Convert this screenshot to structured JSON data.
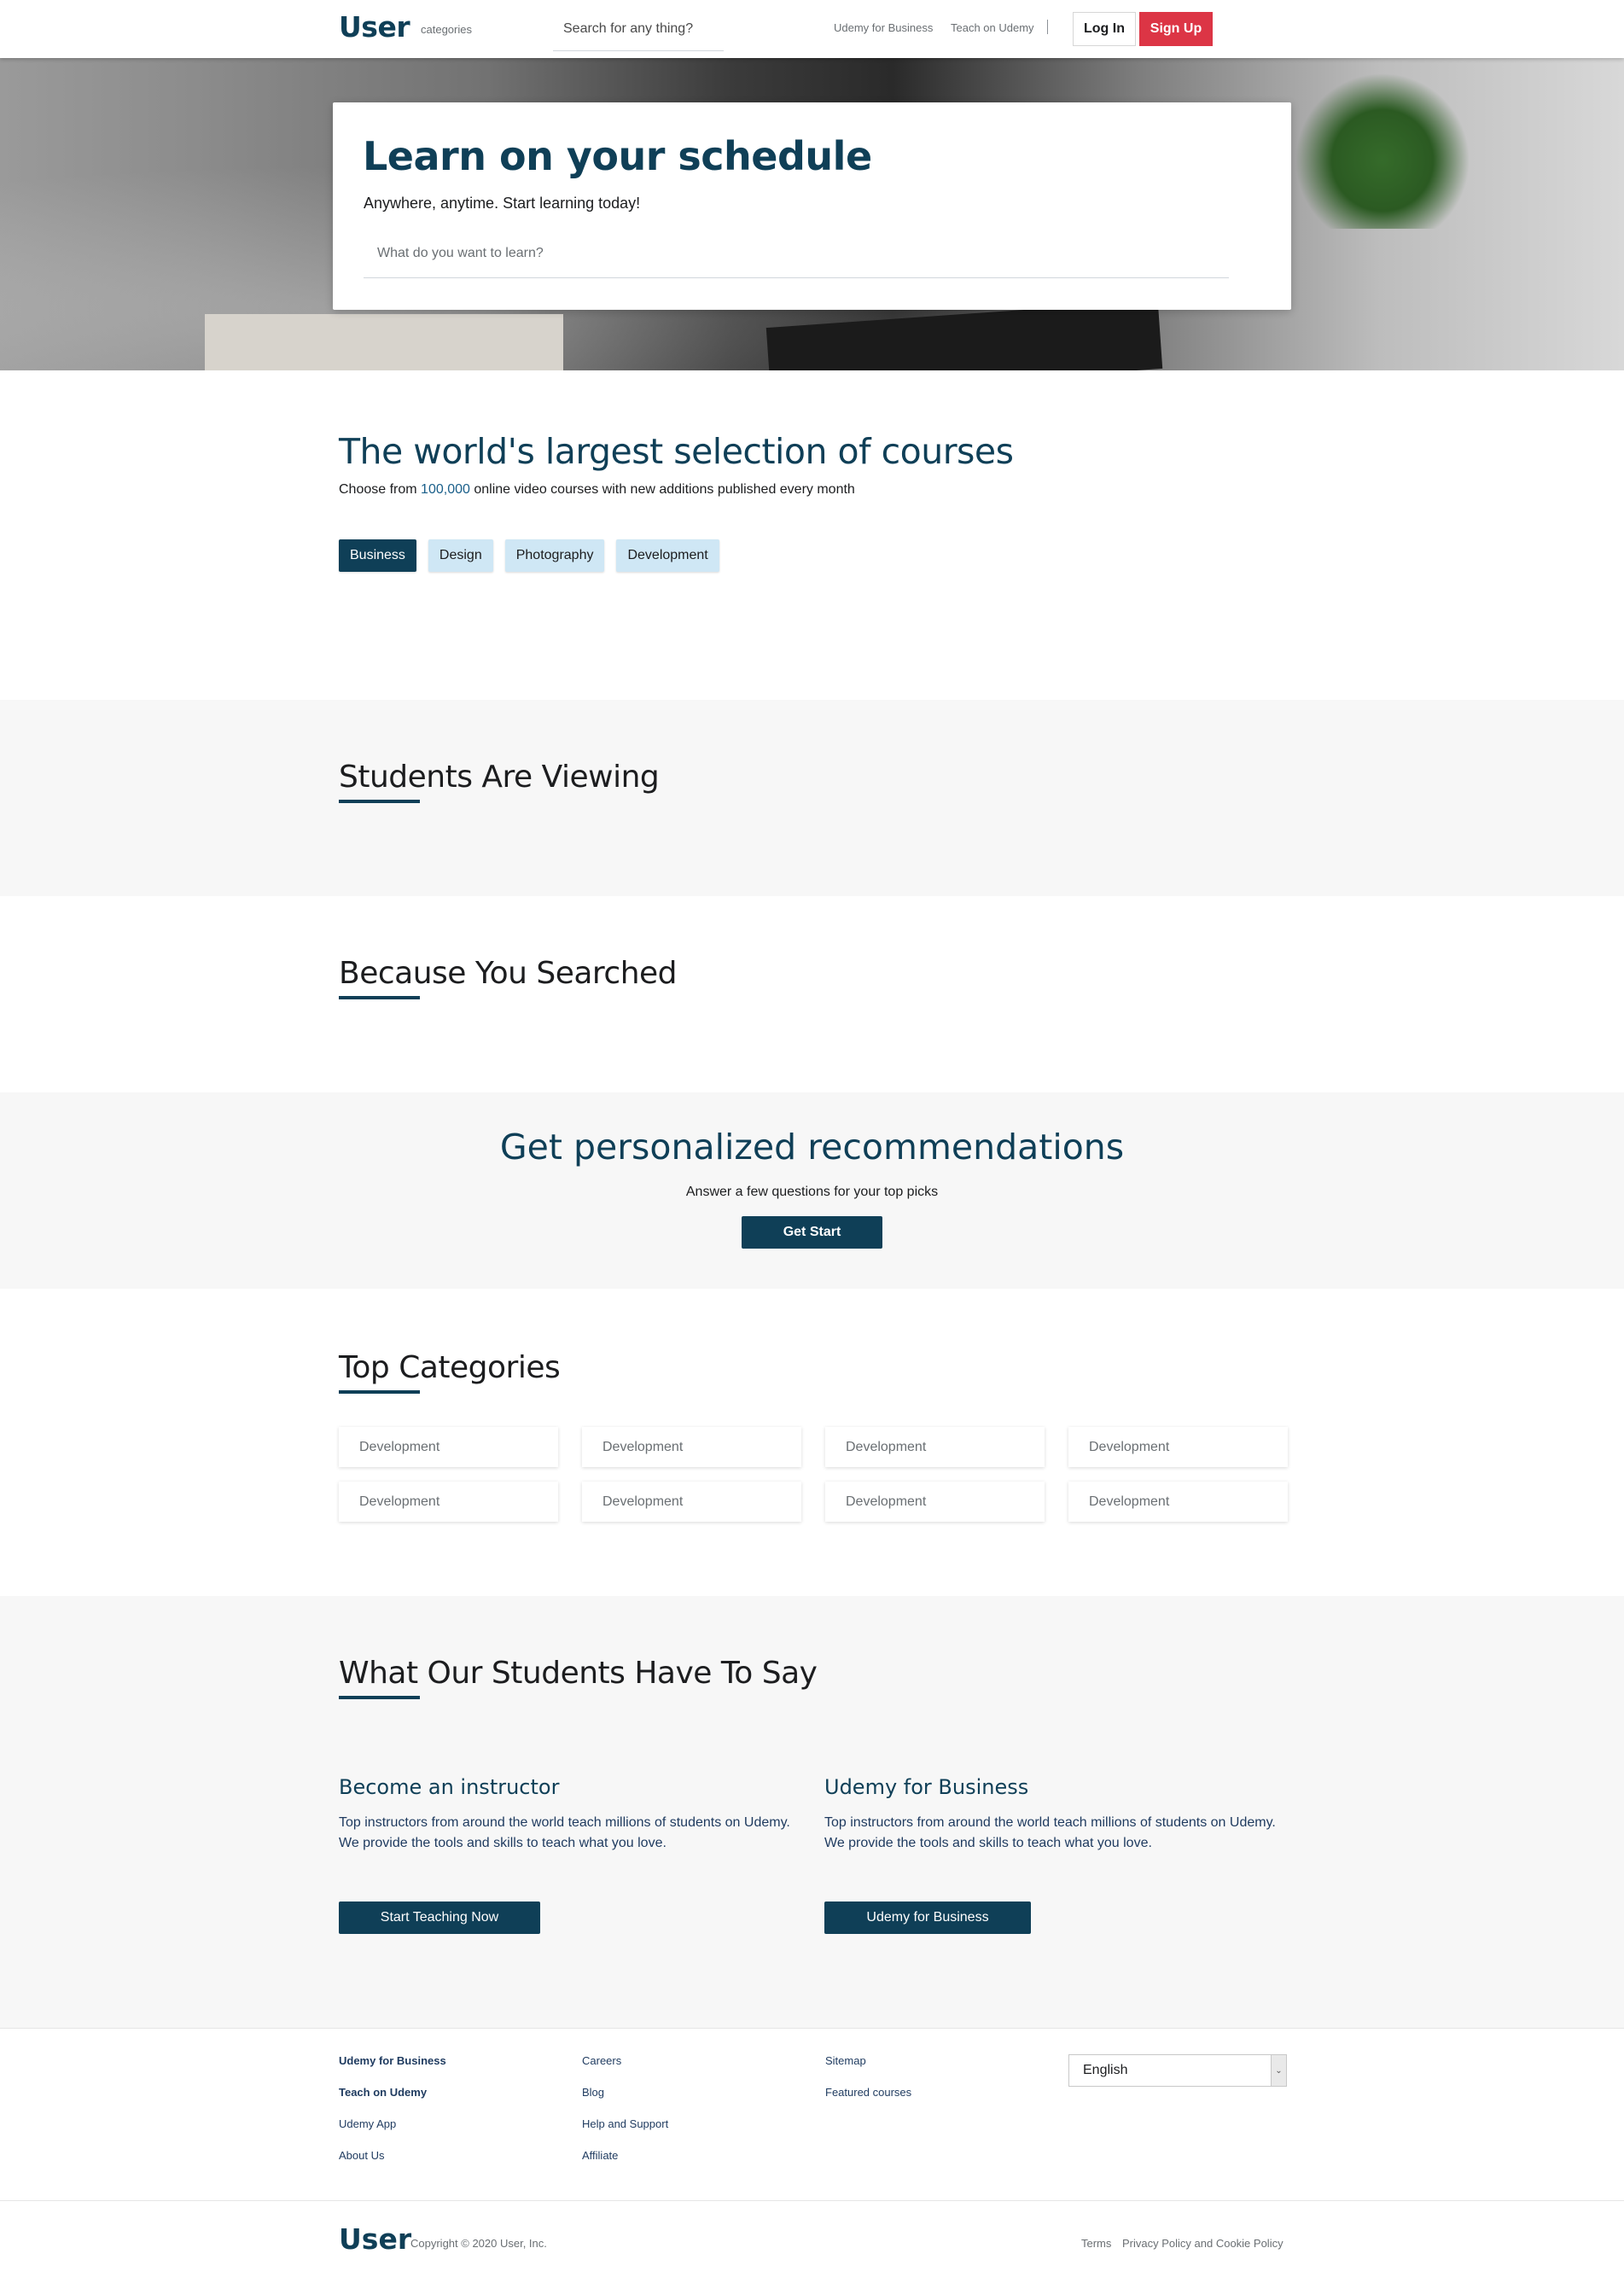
{
  "navbar": {
    "logo": "User",
    "categories": "categories",
    "search_placeholder": "Search for any thing?",
    "links": [
      "Udemy for Business",
      "Teach on Udemy"
    ],
    "login": "Log In",
    "signup": "Sign Up"
  },
  "hero": {
    "title": "Learn on your schedule",
    "subtitle": "Anywhere, anytime. Start learning today!",
    "search_placeholder": "What do you want to learn?"
  },
  "courses": {
    "title": "The world's largest selection of courses",
    "sub_prefix": "Choose from ",
    "sub_number": "100,000",
    "sub_suffix": " online video courses with new additions published every month",
    "tabs": [
      "Business",
      "Design",
      "Photography",
      "Development"
    ],
    "active_tab": "Business"
  },
  "students_viewing": {
    "title": "Students Are Viewing"
  },
  "because_searched": {
    "title": "Because You Searched"
  },
  "personalized": {
    "title": "Get personalized recommendations",
    "subtitle": "Answer a few questions for your top picks",
    "button": "Get Start"
  },
  "top_categories": {
    "title": "Top Categories",
    "items": [
      "Development",
      "Development",
      "Development",
      "Development",
      "Development",
      "Development",
      "Development",
      "Development"
    ]
  },
  "testimonials": {
    "title": "What Our Students Have To Say",
    "columns": [
      {
        "heading": "Become an instructor",
        "text": "Top instructors from around the world teach millions of students on Udemy. We provide the tools and skills to teach what you love.",
        "button": "Start Teaching Now"
      },
      {
        "heading": "Udemy for Business",
        "text": "Top instructors from around the world teach millions of students on Udemy. We provide the tools and skills to teach what you love.",
        "button": "Udemy for Business"
      }
    ]
  },
  "footer": {
    "col1": [
      "Udemy for Business",
      "Teach on Udemy",
      "Udemy App",
      "About Us"
    ],
    "col2": [
      "Careers",
      "Blog",
      "Help and Support",
      "Affiliate"
    ],
    "col3": [
      "Sitemap",
      "Featured courses"
    ],
    "language": "English",
    "logo": "User",
    "copyright": "Copyright © 2020 User, Inc.",
    "bottom_links": [
      "Terms",
      "Privacy Policy and Cookie Policy"
    ]
  },
  "colors": {
    "brand": "#0f3f57",
    "signup": "#dc3545",
    "tab_inactive": "#cfe7f5",
    "band": "#f7f7f7"
  }
}
